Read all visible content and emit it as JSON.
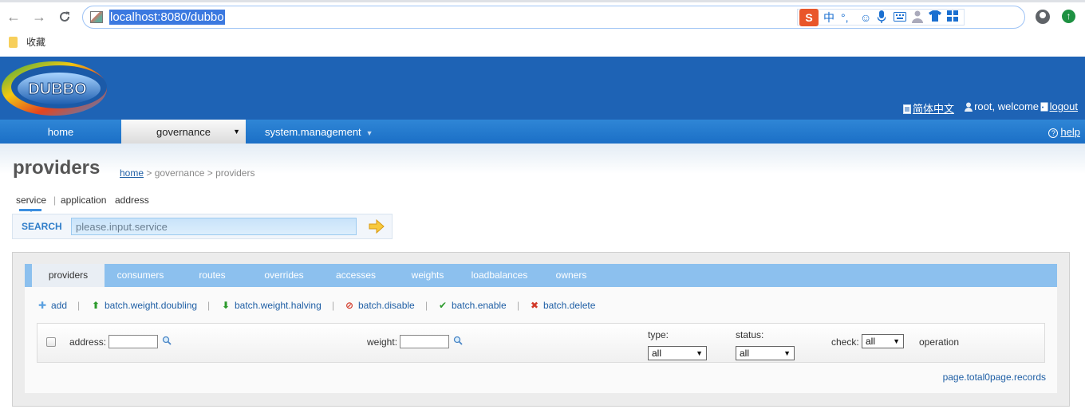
{
  "browser": {
    "url": "localhost:8080/dubbo",
    "ime_icons": [
      "sogou-icon",
      "chinese-mode",
      "punctuation",
      "emoji-icon",
      "mic-icon",
      "keyboard-icon",
      "user-icon",
      "skin-icon",
      "grid-icon"
    ],
    "ime": {
      "logo": "S",
      "mode": "中",
      "punct": "°,"
    },
    "bookmark_folder": "收藏"
  },
  "header": {
    "logo_text": "DUBBO",
    "language_link": "简体中文",
    "user_text": "root, welcome",
    "logout_link": "logout"
  },
  "menu": {
    "home": "home",
    "governance": "governance",
    "system": "system.management",
    "help": "help"
  },
  "page": {
    "title": "providers",
    "breadcrumb_home": "home",
    "breadcrumb_rest": " > governance > providers"
  },
  "search_types": [
    "service",
    "application",
    "address"
  ],
  "search": {
    "label": "SEARCH",
    "placeholder": "please.input.service"
  },
  "tabs": [
    "providers",
    "consumers",
    "routes",
    "overrides",
    "accesses",
    "weights",
    "loadbalances",
    "owners"
  ],
  "actions": {
    "add": "add",
    "doubling": "batch.weight.doubling",
    "halving": "batch.weight.halving",
    "disable": "batch.disable",
    "enable": "batch.enable",
    "delete": "batch.delete"
  },
  "grid": {
    "address_label": "address:",
    "weight_label": "weight:",
    "type_label": "type:",
    "type_value": "all",
    "status_label": "status:",
    "status_value": "all",
    "check_label": "check:",
    "check_value": "all",
    "operation_label": "operation"
  },
  "pager": "page.total0page.records",
  "colors": {
    "header_blue": "#1e63b5",
    "menu_blue": "#2f86d6",
    "tab_blue": "#8cc0ee",
    "link_blue": "#1f5fa5"
  }
}
